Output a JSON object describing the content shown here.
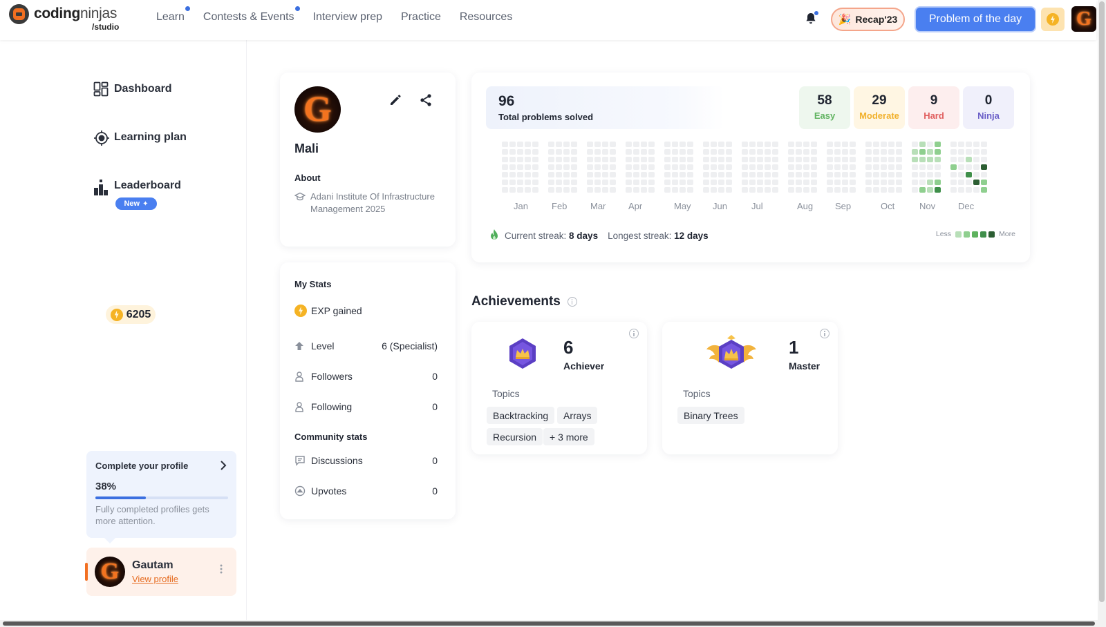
{
  "nav": {
    "logo_main_bold": "coding",
    "logo_main_light": "ninjas",
    "logo_sub": "/studio",
    "links": [
      {
        "label": "Learn",
        "dot": true
      },
      {
        "label": "Contests & Events",
        "dot": true
      },
      {
        "label": "Interview prep",
        "dot": false
      },
      {
        "label": "Practice",
        "dot": false
      },
      {
        "label": "Resources",
        "dot": false
      }
    ],
    "recap_label": "Recap'23",
    "potd_label": "Problem of the day",
    "avatar_letter": "G"
  },
  "sidebar": {
    "items": [
      {
        "label": "Dashboard",
        "icon": "dashboard-icon"
      },
      {
        "label": "Learning plan",
        "icon": "target-icon"
      },
      {
        "label": "Leaderboard",
        "icon": "leaderboard-icon"
      }
    ],
    "new_badge": "New",
    "profile_card": {
      "title": "Complete your profile",
      "percent_label": "38%",
      "percent": 38,
      "note": "Fully completed profiles gets more attention."
    },
    "user": {
      "name": "Gautam",
      "link": "View profile",
      "avatar_letter": "G"
    }
  },
  "profile": {
    "avatar_letter": "G",
    "name": "Mali",
    "about_label": "About",
    "institute": "Adani Institute Of Infrastructure Management 2025"
  },
  "stats": {
    "title": "My Stats",
    "exp_label": "EXP gained",
    "exp_value": "6205",
    "rows": [
      {
        "label": "Level",
        "value": "6 (Specialist)",
        "icon": "arrow-up-icon"
      },
      {
        "label": "Followers",
        "value": "0",
        "icon": "person-icon"
      },
      {
        "label": "Following",
        "value": "0",
        "icon": "person-icon"
      }
    ],
    "community_title": "Community stats",
    "community_rows": [
      {
        "label": "Discussions",
        "value": "0",
        "icon": "chat-icon"
      },
      {
        "label": "Upvotes",
        "value": "0",
        "icon": "upvote-icon"
      }
    ]
  },
  "problems": {
    "total": "96",
    "total_label": "Total problems solved",
    "difficulty": [
      {
        "count": "58",
        "label": "Easy",
        "bg": "#eef7ee",
        "color": "#5fb35f"
      },
      {
        "count": "29",
        "label": "Moderate",
        "bg": "#fff6e3",
        "color": "#f1b02a"
      },
      {
        "count": "9",
        "label": "Hard",
        "bg": "#fdeeee",
        "color": "#e05d5d"
      },
      {
        "count": "0",
        "label": "Ninja",
        "bg": "#f0f0fb",
        "color": "#6b5fc8"
      }
    ],
    "months": [
      "Jan",
      "Feb",
      "Mar",
      "Apr",
      "May",
      "Jun",
      "Jul",
      "Aug",
      "Sep",
      "Oct",
      "Nov",
      "Dec"
    ],
    "streak_current_label": "Current streak:",
    "streak_current": "8 days",
    "streak_longest_label": "Longest streak:",
    "streak_longest": "12 days",
    "legend_less": "Less",
    "legend_more": "More",
    "colors": [
      "#eeeff1",
      "#b8dfb8",
      "#8fcf8f",
      "#5fb35f",
      "#3f8f4a",
      "#2c5e33"
    ]
  },
  "achievements": {
    "title": "Achievements",
    "cards": [
      {
        "count": "6",
        "label": "Achiever",
        "topics_label": "Topics",
        "chips": [
          "Backtracking",
          "Arrays",
          "Recursion",
          "+ 3 more"
        ],
        "badge": "crown-hexagon-icon"
      },
      {
        "count": "1",
        "label": "Master",
        "topics_label": "Topics",
        "chips": [
          "Binary Trees"
        ],
        "badge": "winged-crown-icon"
      }
    ]
  }
}
